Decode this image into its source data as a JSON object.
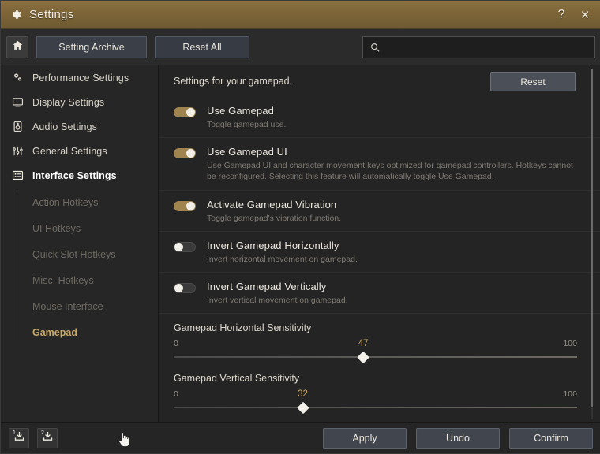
{
  "window": {
    "title": "Settings",
    "gear_icon": "gear-icon",
    "help_label": "?",
    "close_label": "×"
  },
  "toolbar": {
    "home_icon": "home-icon",
    "setting_archive_label": "Setting Archive",
    "reset_all_label": "Reset All",
    "search": {
      "icon": "search-icon",
      "value": "",
      "placeholder": ""
    }
  },
  "sidebar": {
    "items": [
      {
        "label": "Performance Settings",
        "icon": "gears-icon",
        "active": false
      },
      {
        "label": "Display Settings",
        "icon": "monitor-icon",
        "active": false
      },
      {
        "label": "Audio Settings",
        "icon": "speaker-icon",
        "active": false
      },
      {
        "label": "General Settings",
        "icon": "sliders-icon",
        "active": false
      },
      {
        "label": "Interface Settings",
        "icon": "list-icon",
        "active": true
      }
    ],
    "subitems": [
      {
        "label": "Action Hotkeys",
        "active": false
      },
      {
        "label": "UI Hotkeys",
        "active": false
      },
      {
        "label": "Quick Slot Hotkeys",
        "active": false
      },
      {
        "label": "Misc. Hotkeys",
        "active": false
      },
      {
        "label": "Mouse Interface",
        "active": false
      },
      {
        "label": "Gamepad",
        "active": true
      }
    ]
  },
  "content": {
    "header_description": "Settings for your gamepad.",
    "reset_label": "Reset",
    "options": [
      {
        "title": "Use Gamepad",
        "description": "Toggle gamepad use.",
        "state": "on"
      },
      {
        "title": "Use Gamepad UI",
        "description": "Use Gamepad UI and character movement keys optimized for gamepad controllers. Hotkeys cannot be reconfigured. Selecting this feature will automatically toggle Use Gamepad.",
        "state": "on"
      },
      {
        "title": "Activate Gamepad Vibration",
        "description": "Toggle gamepad's vibration function.",
        "state": "on"
      },
      {
        "title": "Invert Gamepad Horizontally",
        "description": "Invert horizontal movement on gamepad.",
        "state": "off"
      },
      {
        "title": "Invert Gamepad Vertically",
        "description": "Invert vertical movement on gamepad.",
        "state": "off"
      }
    ],
    "sliders": [
      {
        "label": "Gamepad Horizontal Sensitivity",
        "min_label": "0",
        "max_label": "100",
        "value": 47,
        "value_label": "47"
      },
      {
        "label": "Gamepad Vertical Sensitivity",
        "min_label": "0",
        "max_label": "100",
        "value": 32,
        "value_label": "32"
      }
    ]
  },
  "footer": {
    "slot1_label": "1",
    "slot2_label": "2",
    "buttons": [
      {
        "label": "Apply"
      },
      {
        "label": "Undo"
      },
      {
        "label": "Confirm"
      }
    ]
  },
  "colors": {
    "titlebar_brown": "#7d6538",
    "accent_gold": "#c9a96a",
    "toggle_on": "#a08450",
    "panel_dark": "#242424",
    "button_blue_gray": "#41454d"
  }
}
